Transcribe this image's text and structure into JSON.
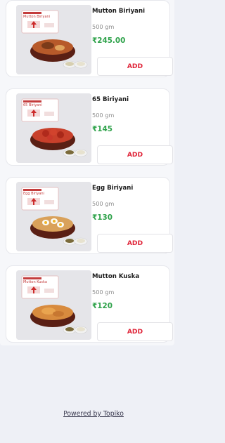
{
  "products": [
    {
      "image_text": "Mutton Biriyani",
      "brand_tag": "Biriyani Center",
      "name": "Mutton Biriyani",
      "weight": "500 gm",
      "price": "₹245.00",
      "add_label": "ADD",
      "food": "rice"
    },
    {
      "image_text": "65 Biriyani",
      "brand_tag": "Biriyani Center",
      "name": "65 Biriyani",
      "weight": "500 gm",
      "price": "₹145",
      "add_label": "ADD",
      "food": "chicken65"
    },
    {
      "image_text": "Egg Biriyani",
      "brand_tag": "Biriyani Center",
      "name": "Egg Biriyani",
      "weight": "500 gm",
      "price": "₹130",
      "add_label": "ADD",
      "food": "egg"
    },
    {
      "image_text": "Mutton Kuska",
      "brand_tag": "Biriyani Center",
      "name": "Mutton Kuska",
      "weight": "500 gm",
      "price": "₹120",
      "add_label": "ADD",
      "food": "kuska"
    }
  ],
  "colors": {
    "price": "#2ea24a",
    "add_text": "#e0263a",
    "background": "#eef0f6"
  },
  "footer": {
    "powered_by": "Powered by Topiko"
  }
}
